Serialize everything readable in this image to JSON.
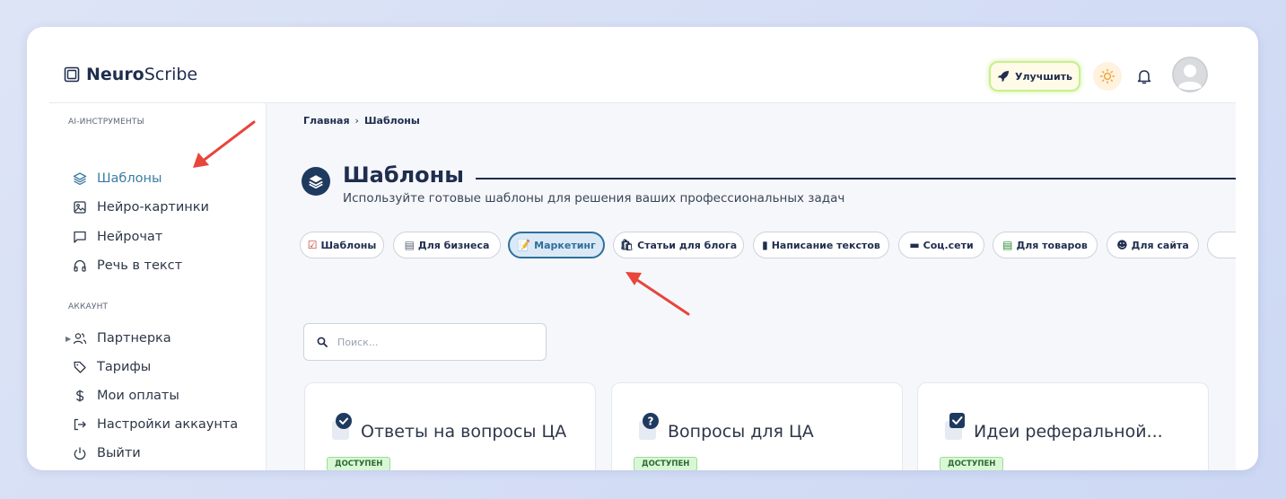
{
  "app": {
    "logo_bold": "Neuro",
    "logo_rest": "Scribe"
  },
  "topbar": {
    "upgrade_label": "Улучшить"
  },
  "sidebar": {
    "sections": [
      {
        "title": "AI-ИНСТРУМЕНТЫ",
        "items": [
          {
            "label": "Шаблоны",
            "icon": "layers-icon",
            "active": true
          },
          {
            "label": "Нейро-картинки",
            "icon": "image-icon"
          },
          {
            "label": "Нейрочат",
            "icon": "chat-icon"
          },
          {
            "label": "Речь в текст",
            "icon": "headphones-icon"
          }
        ]
      },
      {
        "title": "АККАУНТ",
        "items": [
          {
            "label": "Партнерка",
            "icon": "users-icon",
            "expandable": true
          },
          {
            "label": "Тарифы",
            "icon": "tag-icon"
          },
          {
            "label": "Мои оплаты",
            "icon": "dollar-icon"
          },
          {
            "label": "Настройки аккаунта",
            "icon": "login-icon"
          },
          {
            "label": "Выйти",
            "icon": "power-icon"
          }
        ]
      }
    ]
  },
  "breadcrumb": {
    "home": "Главная",
    "separator": "›",
    "current": "Шаблоны"
  },
  "page": {
    "title": "Шаблоны",
    "subtitle": "Используйте готовые шаблоны для решения ваших профессиональных задач"
  },
  "filters": [
    {
      "label": "Шаблоны",
      "emoji": "☑"
    },
    {
      "label": "Для бизнеса",
      "emoji": "▤"
    },
    {
      "label": "Маркетинг",
      "emoji": "📝",
      "active": true
    },
    {
      "label": "Статьи для блога",
      "emoji": "🛍"
    },
    {
      "label": "Написание текстов",
      "emoji": "▮"
    },
    {
      "label": "Соц.сети",
      "emoji": "▬"
    },
    {
      "label": "Для товаров",
      "emoji": "▤"
    },
    {
      "label": "Для сайта",
      "emoji": "☻"
    }
  ],
  "search": {
    "placeholder": "Поиск..."
  },
  "cards": [
    {
      "title": "Ответы на вопросы ЦА",
      "badge": "ДОСТУПЕН",
      "icon": "check-circle-icon"
    },
    {
      "title": "Вопросы для ЦА",
      "badge": "ДОСТУПЕН",
      "icon": "question-circle-icon"
    },
    {
      "title": "Идеи реферальной...",
      "badge": "ДОСТУПЕН",
      "icon": "checkbox-icon"
    }
  ],
  "colors": {
    "accent": "#3a7ca5",
    "navy": "#1f2d4e",
    "badge_bg": "#d9f7d6",
    "annotation_arrow": "#e8453c"
  }
}
